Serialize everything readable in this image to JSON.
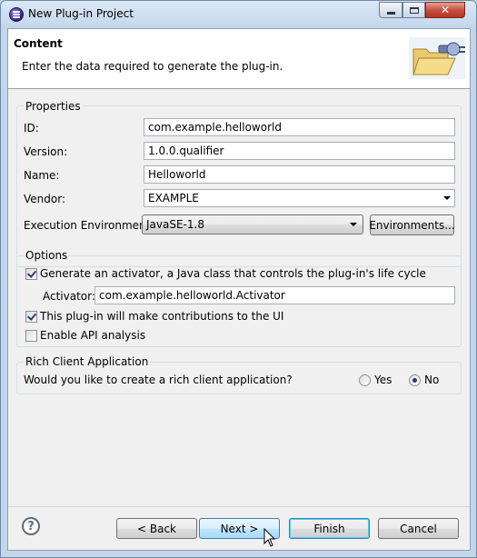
{
  "window": {
    "title": "New Plug-in Project"
  },
  "header": {
    "title": "Content",
    "description": "Enter the data required to generate the plug-in."
  },
  "properties": {
    "group_label": "Properties",
    "id_label": "ID:",
    "id_value": "com.example.helloworld",
    "version_label": "Version:",
    "version_value": "1.0.0.qualifier",
    "name_label": "Name:",
    "name_value": "Helloworld",
    "vendor_label": "Vendor:",
    "vendor_value": "EXAMPLE",
    "ee_label": "Execution Environment:",
    "ee_value": "JavaSE-1.8",
    "environments_button": "Environments..."
  },
  "options": {
    "group_label": "Options",
    "generate_activator": {
      "label": "Generate an activator, a Java class that controls the plug-in's life cycle",
      "checked": true
    },
    "activator_label": "Activator:",
    "activator_value": "com.example.helloworld.Activator",
    "ui_contributions": {
      "label": "This plug-in will make contributions to the UI",
      "checked": true
    },
    "api_analysis": {
      "label": "Enable API analysis",
      "checked": false
    }
  },
  "rcp": {
    "group_label": "Rich Client Application",
    "question": "Would you like to create a rich client application?",
    "yes_label": "Yes",
    "no_label": "No",
    "selected": "No"
  },
  "buttons": {
    "back": "< Back",
    "next": "Next >",
    "finish": "Finish",
    "cancel": "Cancel",
    "help": "?"
  },
  "icons": [
    "eclipse-icon",
    "folder-plugin-icon",
    "help-icon",
    "mouse-cursor-icon"
  ]
}
